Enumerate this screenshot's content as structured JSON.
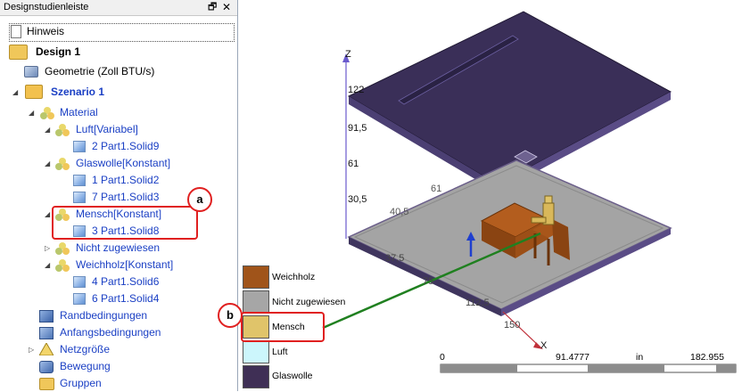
{
  "sidebar": {
    "title": "Designstudienleiste",
    "pin_icon": "pin-icon",
    "close_icon": "close-icon",
    "hint": "Hinweis",
    "design": "Design 1",
    "geometry": "Geometrie (Zoll BTU/s)",
    "scenario": "Szenario 1",
    "material": "Material",
    "luft": "Luft[Variabel]",
    "luft_solid": "2 Part1.Solid9",
    "glaswolle": "Glaswolle[Konstant]",
    "glaswolle_solid1": "1 Part1.Solid2",
    "glaswolle_solid2": "7 Part1.Solid3",
    "mensch": "Mensch[Konstant]",
    "mensch_solid": "3 Part1.Solid8",
    "nicht": "Nicht zugewiesen",
    "weichholz": "Weichholz[Konstant]",
    "weichholz_solid1": "4 Part1.Solid6",
    "weichholz_solid2": "6 Part1.Solid4",
    "randbedingungen": "Randbedingungen",
    "anfangsbedingungen": "Anfangsbedingungen",
    "netzgroesse": "Netzgröße",
    "bewegung": "Bewegung",
    "gruppen": "Gruppen"
  },
  "callouts": {
    "a": "a",
    "b": "b"
  },
  "viewport": {
    "z_axis": "Z",
    "x_axis": "X",
    "z_ticks": [
      "122",
      "91,5",
      "61",
      "30,5"
    ],
    "floor_ticks": [
      "61",
      "40,5",
      "37,5",
      "75",
      "112,5",
      "150"
    ]
  },
  "legend": {
    "items": [
      {
        "label": "Weichholz",
        "color": "#a0541a"
      },
      {
        "label": "Nicht zugewiesen",
        "color": "#a6a6a6"
      },
      {
        "label": "Mensch",
        "color": "#e0c46a"
      },
      {
        "label": "Luft",
        "color": "#ccf6fc"
      },
      {
        "label": "Glaswolle",
        "color": "#3f2f55"
      }
    ]
  },
  "scale_bar": {
    "start": "0",
    "mid": "91.4777",
    "unit": "in",
    "end": "182.955"
  }
}
